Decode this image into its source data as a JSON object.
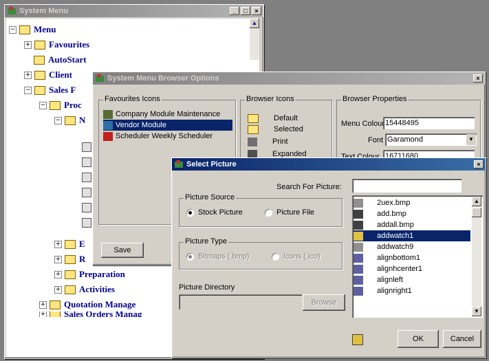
{
  "system_menu": {
    "title": "System Menu",
    "tree": [
      {
        "label": "Menu",
        "expander": "−"
      },
      {
        "label": "Favourites",
        "expander": "+"
      },
      {
        "label": "AutoStart",
        "expander": ""
      },
      {
        "label": "Client",
        "expander": "+"
      },
      {
        "label": "Sales F",
        "expander": "−"
      },
      {
        "label": "Proc",
        "expander": "−"
      },
      {
        "label": "N",
        "expander": "−"
      },
      {
        "label": "E",
        "expander": "+"
      },
      {
        "label": "R",
        "expander": "+"
      },
      {
        "label": "Preparation",
        "expander": "+"
      },
      {
        "label": "Activities",
        "expander": "+"
      },
      {
        "label": "Quotation Manage",
        "expander": "+"
      },
      {
        "label": "Sales Orders Manag",
        "expander": "+"
      }
    ]
  },
  "browser_options": {
    "title": "System Menu Browser Options",
    "favourites_group": "Favourites Icons",
    "favourites": [
      "Company Module Maintenance",
      "Vendor Module",
      "Scheduler Weekly Scheduler"
    ],
    "browser_icons_group": "Browser Icons",
    "browser_icons": [
      "Default",
      "Selected",
      "Print",
      "Expanded"
    ],
    "properties_group": "Browser Properties",
    "menu_colour_label": "Menu Colour",
    "menu_colour_value": "15448495",
    "font_label": "Font",
    "font_value": "Garamond",
    "text_colour_label": "Text Colour",
    "text_colour_value": "16711680",
    "save_label": "Save"
  },
  "select_picture": {
    "title": "Select Picture",
    "search_label": "Search For Picture:",
    "search_value": "",
    "source_group": "Picture Source",
    "source_stock": "Stock Picture",
    "source_file": "Picture File",
    "type_group": "Picture Type",
    "type_bitmap": "Bitmaps (.bmp)",
    "type_icon": "Icons (.ico)",
    "directory_label": "Picture Directory",
    "directory_value": "",
    "browse_label": "Browse",
    "pictures": [
      "2uex.bmp",
      "add.bmp",
      "addall.bmp",
      "addwatch1",
      "addwatch9",
      "alignbottom1",
      "alignhcenter1",
      "alignleft",
      "alignright1"
    ],
    "selected_index": 3,
    "ok_label": "OK",
    "cancel_label": "Cancel"
  }
}
